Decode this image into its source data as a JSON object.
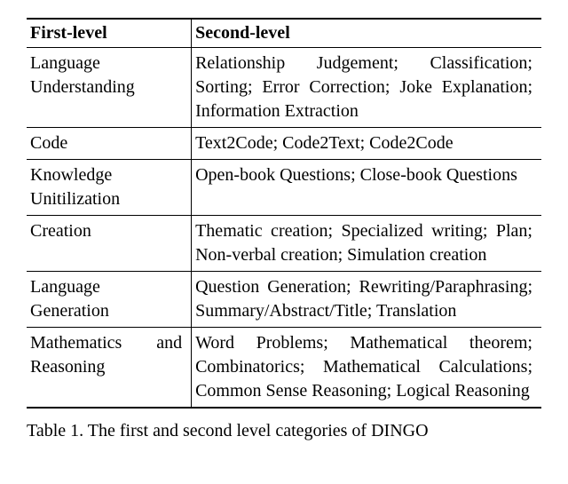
{
  "table": {
    "headers": {
      "col1": "First-level",
      "col2": "Second-level"
    },
    "rows": [
      {
        "first": "Language Understanding",
        "second": "Relationship Judgement; Classification; Sorting; Error Correction; Joke Explanation; Information Extraction"
      },
      {
        "first": "Code",
        "second": "Text2Code; Code2Text; Code2Code"
      },
      {
        "first": "Knowledge Unitilization",
        "second": "Open-book Questions; Close-book Questions"
      },
      {
        "first": "Creation",
        "second": "Thematic creation; Specialized writing; Plan; Non-verbal creation; Simulation creation"
      },
      {
        "first": "Language Generation",
        "second": "Question Generation; Rewriting/Paraphrasing; Summary/Abstract/Title; Translation"
      },
      {
        "first": "Mathematics and Reasoning",
        "second": "Word Problems; Mathematical theorem; Combinatorics; Mathematical Calculations; Common Sense Reasoning; Logical Reasoning"
      }
    ]
  },
  "caption": "Table 1. The first and second level categories of DINGO"
}
